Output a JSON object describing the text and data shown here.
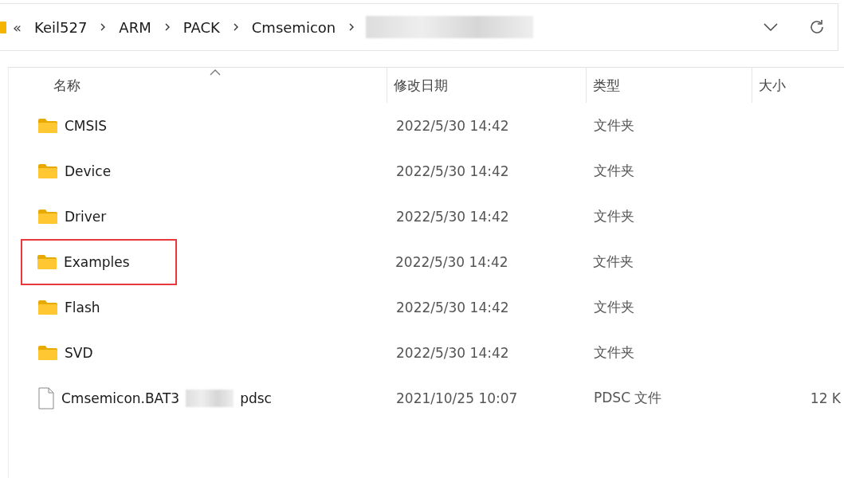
{
  "breadcrumb": [
    {
      "label": "«",
      "kind": "overflow"
    },
    {
      "label": "Keil527",
      "kind": "crumb"
    },
    {
      "label": "ARM",
      "kind": "crumb"
    },
    {
      "label": "PACK",
      "kind": "crumb"
    },
    {
      "label": "Cmsemicon",
      "kind": "crumb"
    },
    {
      "kind": "redacted"
    }
  ],
  "columns": [
    {
      "label": "名称",
      "sorted": true
    },
    {
      "label": "修改日期",
      "sorted": false
    },
    {
      "label": "类型",
      "sorted": false
    },
    {
      "label": "大小",
      "sorted": false
    }
  ],
  "rows": [
    {
      "kind": "folder",
      "name": "CMSIS",
      "date": "2022/5/30 14:42",
      "type": "文件夹",
      "highlighted": false
    },
    {
      "kind": "folder",
      "name": "Device",
      "date": "2022/5/30 14:42",
      "type": "文件夹",
      "highlighted": false
    },
    {
      "kind": "folder",
      "name": "Driver",
      "date": "2022/5/30 14:42",
      "type": "文件夹",
      "highlighted": false
    },
    {
      "kind": "folder",
      "name": "Examples",
      "date": "2022/5/30 14:42",
      "type": "文件夹",
      "highlighted": true
    },
    {
      "kind": "folder",
      "name": "Flash",
      "date": "2022/5/30 14:42",
      "type": "文件夹",
      "highlighted": false
    },
    {
      "kind": "folder",
      "name": "SVD",
      "date": "2022/5/30 14:42",
      "type": "文件夹",
      "highlighted": false
    },
    {
      "kind": "file",
      "name": "Cmsemicon.BAT3",
      "name_end": "pdsc",
      "redacted": true,
      "date": "2021/10/25 10:07",
      "type": "PDSC 文件",
      "size": "12 K",
      "highlighted": false
    }
  ]
}
